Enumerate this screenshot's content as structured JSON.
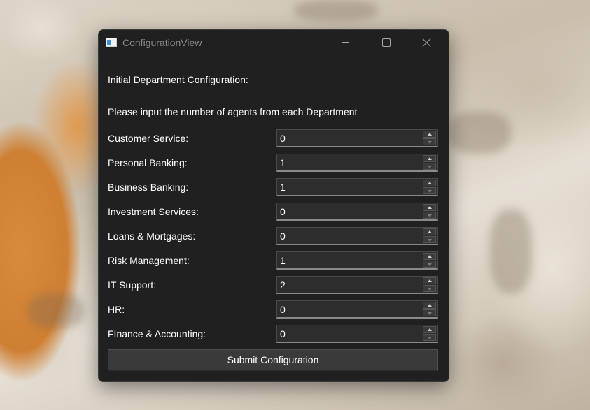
{
  "window": {
    "title": "ConfigurationView",
    "icon": "app-window-icon",
    "controls": [
      "minimize-icon",
      "maximize-icon",
      "close-icon"
    ]
  },
  "form": {
    "heading": "Initial Department Configuration:",
    "instructions": "Please input the number of agents from each Department",
    "departments": [
      {
        "label": "Customer Service:",
        "value": "0"
      },
      {
        "label": "Personal Banking:",
        "value": "1"
      },
      {
        "label": "Business Banking:",
        "value": "1"
      },
      {
        "label": "Investment Services:",
        "value": "0"
      },
      {
        "label": "Loans & Mortgages:",
        "value": "0"
      },
      {
        "label": "Risk Management:",
        "value": "1"
      },
      {
        "label": "IT Support:",
        "value": "2"
      },
      {
        "label": "HR:",
        "value": "0"
      },
      {
        "label": "FInance & Accounting:",
        "value": "0"
      }
    ],
    "submit_label": "Submit Configuration"
  },
  "colors": {
    "window_background": "#202020",
    "spinbox_background": "#2d2d2d",
    "button_background": "#3a3a3a",
    "text": "#ffffff",
    "title_text": "#8a8a8a"
  }
}
